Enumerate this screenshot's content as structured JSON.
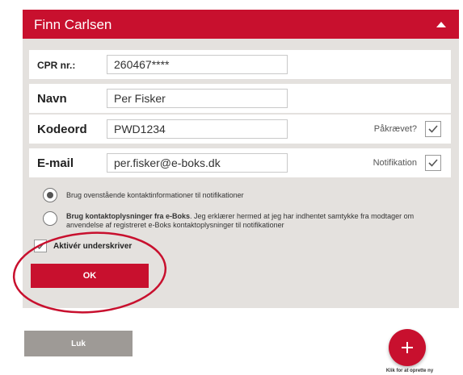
{
  "header": {
    "title": "Finn Carlsen"
  },
  "form": {
    "cpr": {
      "label": "CPR nr.:",
      "value": "260467****"
    },
    "name": {
      "label": "Navn",
      "value": "Per Fisker"
    },
    "password": {
      "label": "Kodeord",
      "value": "PWD1234",
      "check_label": "Påkrævet?",
      "checked": true
    },
    "email": {
      "label": "E-mail",
      "value": "per.fisker@e-boks.dk",
      "check_label": "Notifikation",
      "checked": true
    }
  },
  "options": {
    "option1": {
      "text": "Brug ovenstående kontaktinformationer til notifikationer",
      "selected": true
    },
    "option2": {
      "bold_text": "Brug kontaktoplysninger fra e-Boks",
      "text_line1": ". Jeg erklærer hermed at jeg har indhentet samtykke fra modtager om",
      "text_line2": "anvendelse af registreret e-Boks kontaktoplysninger til notifikationer",
      "selected": false
    }
  },
  "signer": {
    "label": "Aktivér underskriver",
    "checked": true
  },
  "buttons": {
    "ok": "OK",
    "close": "Luk",
    "add_caption": "Klik for at oprette ny"
  },
  "colors": {
    "brand_red": "#c8102e",
    "panel_bg": "#e4e1de",
    "close_gray": "#9e9a96"
  }
}
